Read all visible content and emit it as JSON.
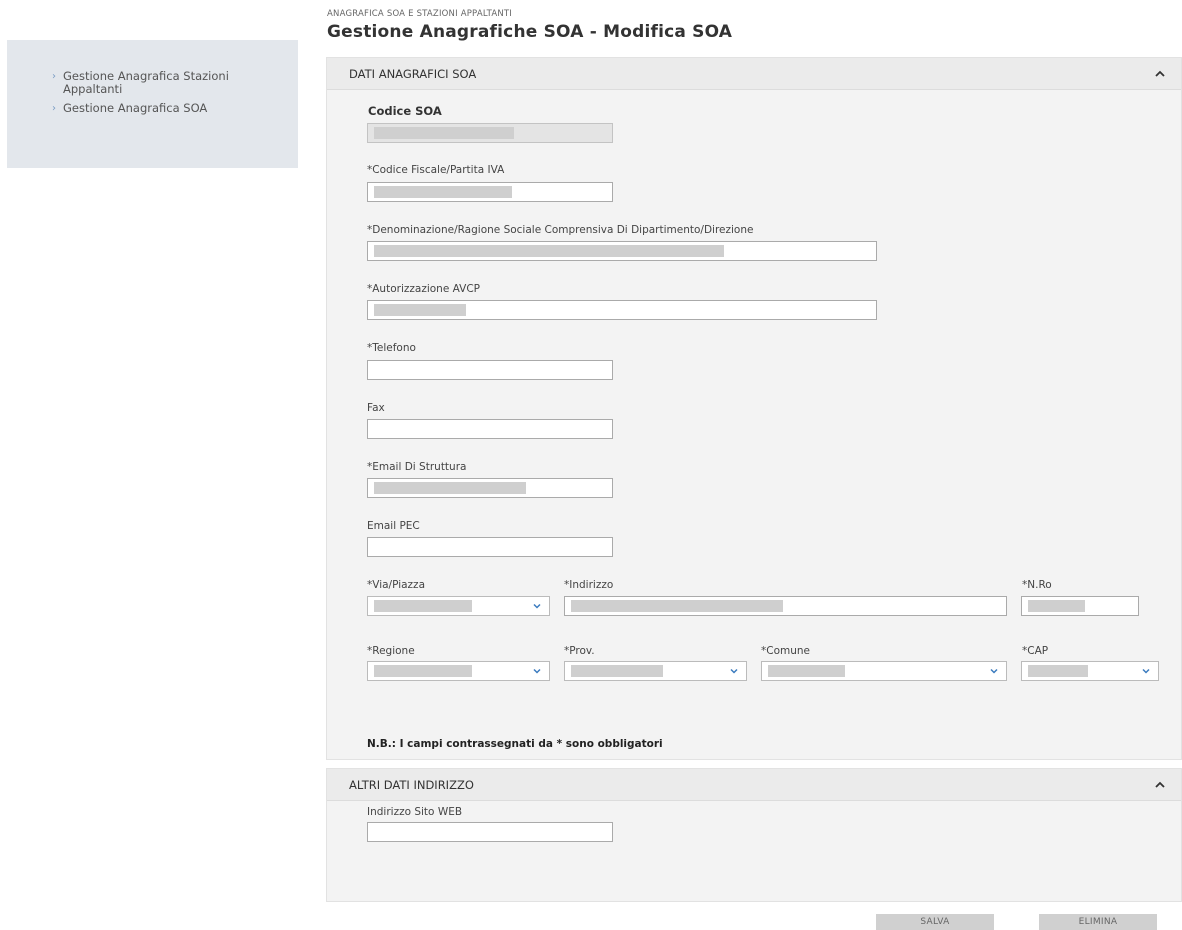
{
  "sidebar": {
    "items": [
      {
        "label": "Gestione Anagrafica Stazioni Appaltanti"
      },
      {
        "label": "Gestione Anagrafica SOA"
      }
    ]
  },
  "header": {
    "breadcrumb": "ANAGRAFICA SOA E STAZIONI APPALTANTI",
    "title": "Gestione Anagrafiche SOA - Modifica SOA"
  },
  "section1": {
    "title": "DATI ANAGRAFICI SOA",
    "fields": {
      "codice_soa": "Codice SOA",
      "codice_fiscale": "*Codice Fiscale/Partita IVA",
      "denominazione": "*Denominazione/Ragione Sociale Comprensiva Di Dipartimento/Direzione",
      "autorizzazione": "*Autorizzazione AVCP",
      "telefono": "*Telefono",
      "fax": "Fax",
      "email_struttura": "*Email Di Struttura",
      "email_pec": "Email PEC",
      "via_piazza": "*Via/Piazza",
      "indirizzo": "*Indirizzo",
      "n_ro": "*N.Ro",
      "regione": "*Regione",
      "prov": "*Prov.",
      "comune": "*Comune",
      "cap": "*CAP"
    },
    "note": "N.B.: I campi contrassegnati da * sono obbligatori"
  },
  "section2": {
    "title": "ALTRI DATI INDIRIZZO",
    "fields": {
      "sito_web": "Indirizzo Sito WEB"
    }
  },
  "actions": {
    "save": "SALVA",
    "delete": "ELIMINA"
  },
  "colors": {
    "sidebar_bg": "#e3e7ec",
    "panel_bg": "#f3f3f3",
    "chevron_accent": "#7a9cc4"
  }
}
